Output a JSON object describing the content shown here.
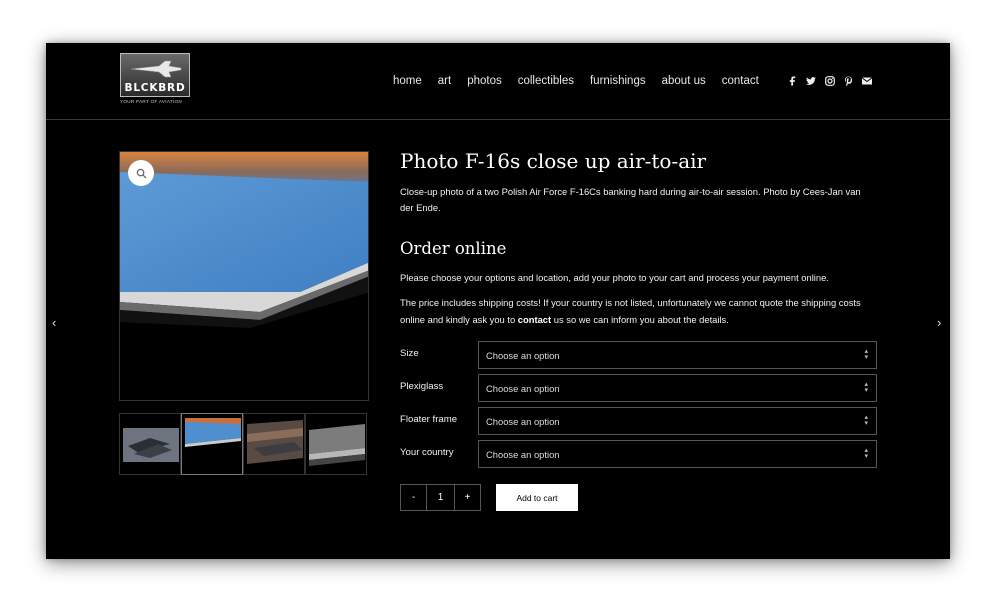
{
  "logo": {
    "word": "BLCKBRD",
    "tagline": "YOUR PART OF AVIATION"
  },
  "nav": [
    "home",
    "art",
    "photos",
    "collectibles",
    "furnishings",
    "about us",
    "contact"
  ],
  "social": [
    "facebook-icon",
    "twitter-icon",
    "instagram-icon",
    "pinterest-icon",
    "mail-icon"
  ],
  "carousel": {
    "prev": "‹",
    "next": "›"
  },
  "product": {
    "title": "Photo F-16s close up air-to-air",
    "description": "Close-up photo of a two Polish Air Force F-16Cs banking hard during air-to-air session. Photo by Cees-Jan van der Ende."
  },
  "order": {
    "heading": "Order online",
    "intro": "Please choose your options and location, add your photo to your cart and process your payment online.",
    "note_before": "The price includes shipping costs! If your country is not listed, unfortunately we cannot quote the shipping costs online and kindly ask you to ",
    "note_link": "contact",
    "note_after": " us so we can inform you about the details."
  },
  "options": [
    {
      "label": "Size",
      "value": "Choose an option"
    },
    {
      "label": "Plexiglass",
      "value": "Choose an option"
    },
    {
      "label": "Floater frame",
      "value": "Choose an option"
    },
    {
      "label": "Your country",
      "value": "Choose an option"
    }
  ],
  "quantity": {
    "minus": "-",
    "value": "1",
    "plus": "+"
  },
  "add_to_cart": "Add to cart",
  "colors": {
    "background": "#000000",
    "button": "#ffffff",
    "accent_blue": "#4f8fcf",
    "accent_orange": "#c8703a"
  }
}
